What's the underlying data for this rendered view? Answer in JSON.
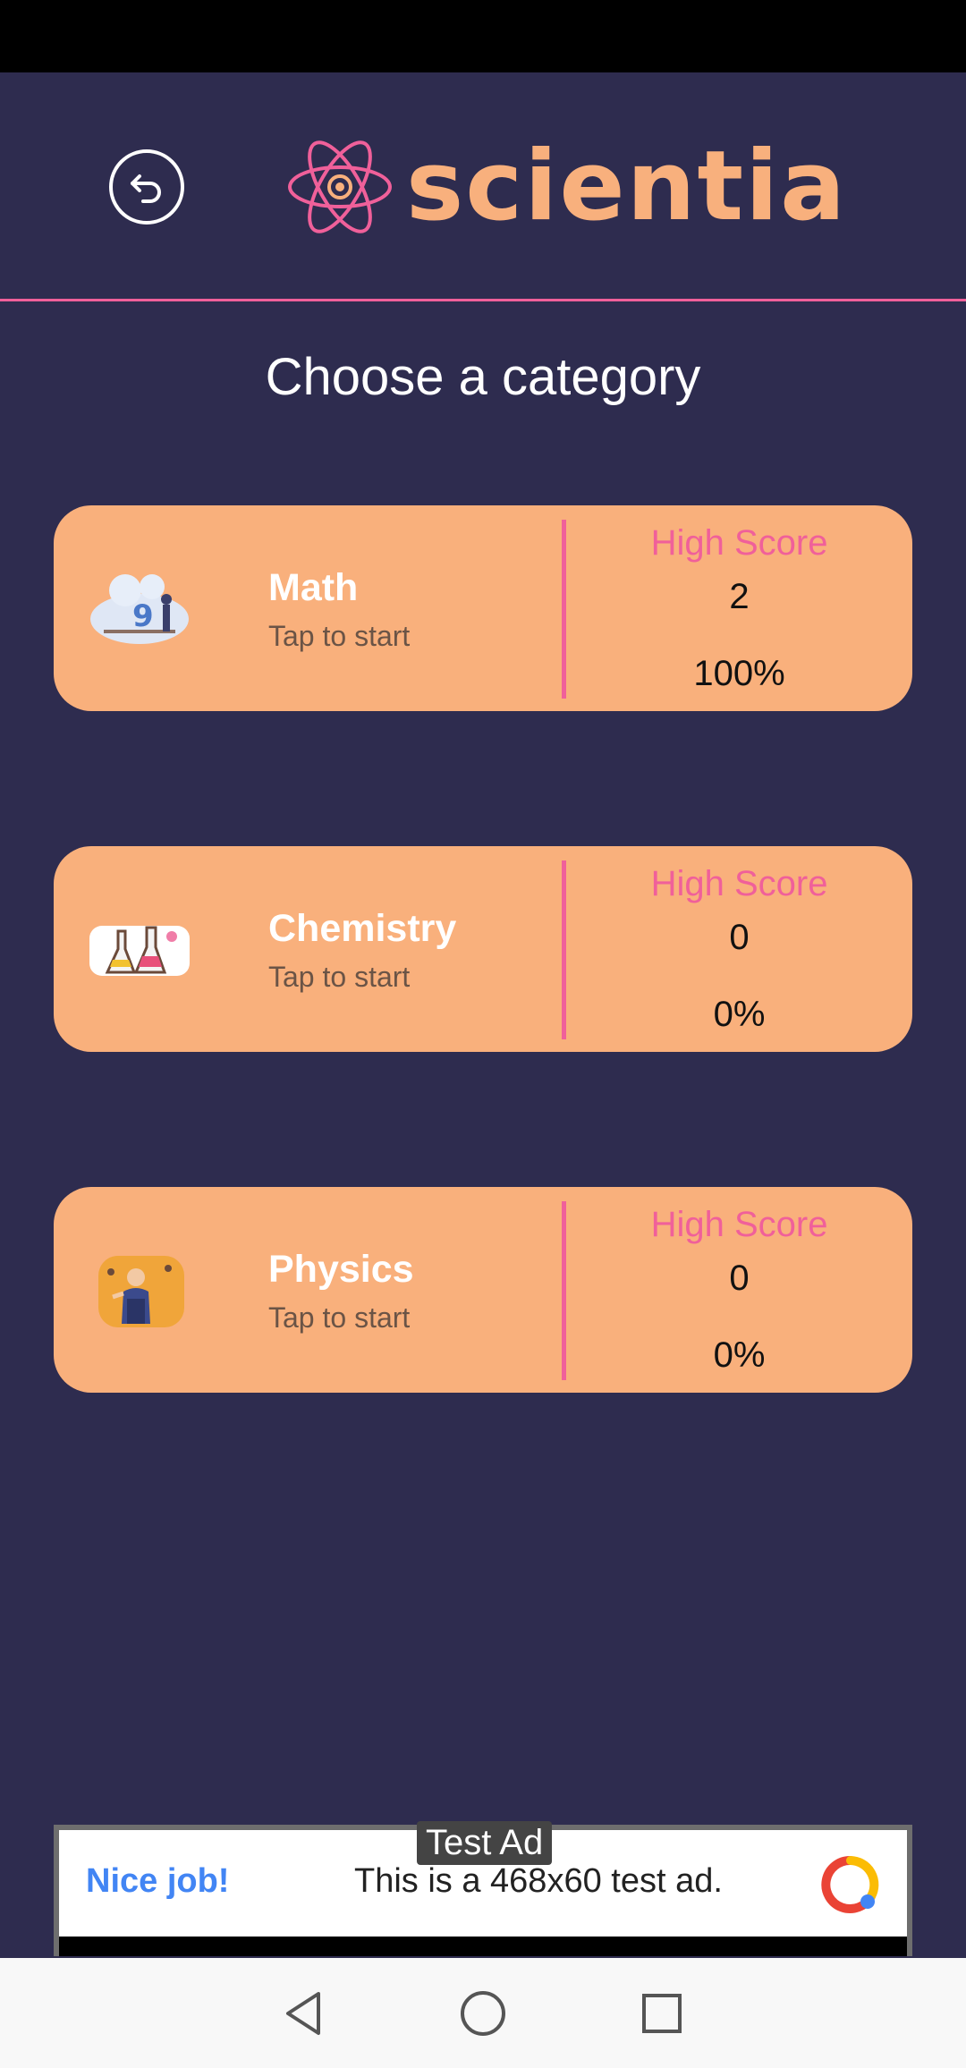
{
  "header": {
    "logo_text": "scientia"
  },
  "page": {
    "title": "Choose a category"
  },
  "categories": [
    {
      "name": "Math",
      "subtitle": "Tap to start",
      "score_label": "High Score",
      "score": "2",
      "percent": "100%"
    },
    {
      "name": "Chemistry",
      "subtitle": "Tap to start",
      "score_label": "High Score",
      "score": "0",
      "percent": "0%"
    },
    {
      "name": "Physics",
      "subtitle": "Tap to start",
      "score_label": "High Score",
      "score": "0",
      "percent": "0%"
    }
  ],
  "ad": {
    "tag": "Test Ad",
    "headline": "Nice job!",
    "text": "This is a 468x60 test ad."
  },
  "colors": {
    "background": "#2e2c4f",
    "accent_pink": "#f0609a",
    "card": "#f9b07c",
    "logo": "#f8b07d"
  },
  "icons": {
    "back": "back-arrow-circle-icon",
    "logo": "atom-icon",
    "nav_back": "triangle-back-icon",
    "nav_home": "circle-home-icon",
    "nav_recents": "square-recents-icon"
  }
}
